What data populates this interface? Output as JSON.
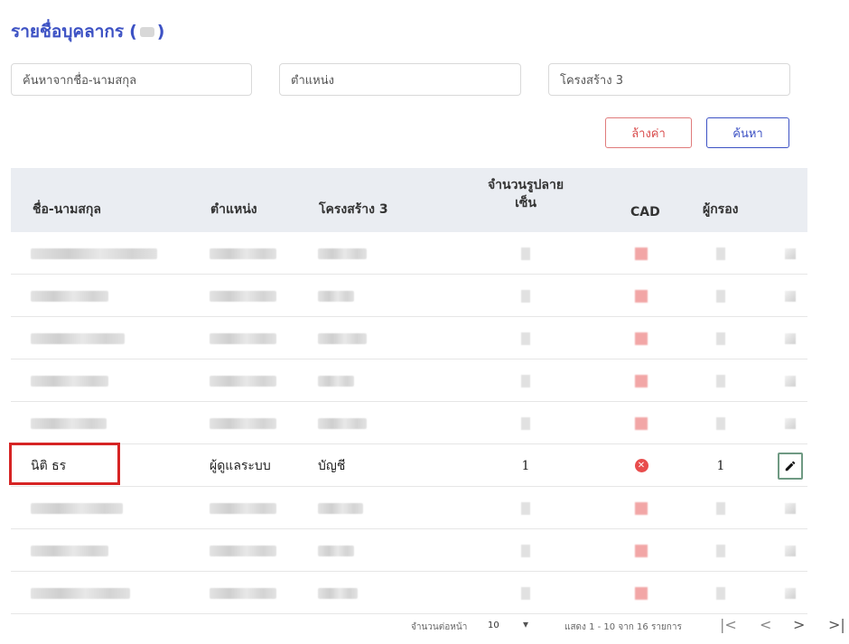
{
  "page": {
    "title": "รายชื่อบุคลากร",
    "title_open": "(",
    "title_close": ")"
  },
  "filters": {
    "name_placeholder": "ค้นหาจากชื่อ-นามสกุล",
    "position_placeholder": "ตำแหน่ง",
    "structure_placeholder": "โครงสร้าง 3"
  },
  "buttons": {
    "clear": "ล้างค่า",
    "search": "ค้นหา"
  },
  "table": {
    "headers": {
      "name": "ชื่อ-นามสกุล",
      "position": "ตำแหน่ง",
      "structure": "โครงสร้าง 3",
      "count_line1": "จำนวนรูปลาย",
      "count_line2": "เซ็น",
      "cad": "CAD",
      "guardian": "ผู้กรอง"
    },
    "visible_row": {
      "name": "นิติ ธร",
      "position": "ผู้ดูแลระบบ",
      "structure": "บัญชี",
      "count": "1",
      "cad_icon": "cancel-circle-icon",
      "guardian": "1",
      "edit_icon": "pencil-icon"
    }
  },
  "pagination": {
    "rows_per_page_label": "จำนวนต่อหน้า",
    "rows_per_page": "10",
    "range_text": "แสดง 1 - 10 จาก 16 รายการ"
  },
  "colors": {
    "accent": "#3d52c4",
    "danger": "#d94c4c",
    "header_bg": "#eaedf2",
    "edit_border": "#6f9a83"
  }
}
